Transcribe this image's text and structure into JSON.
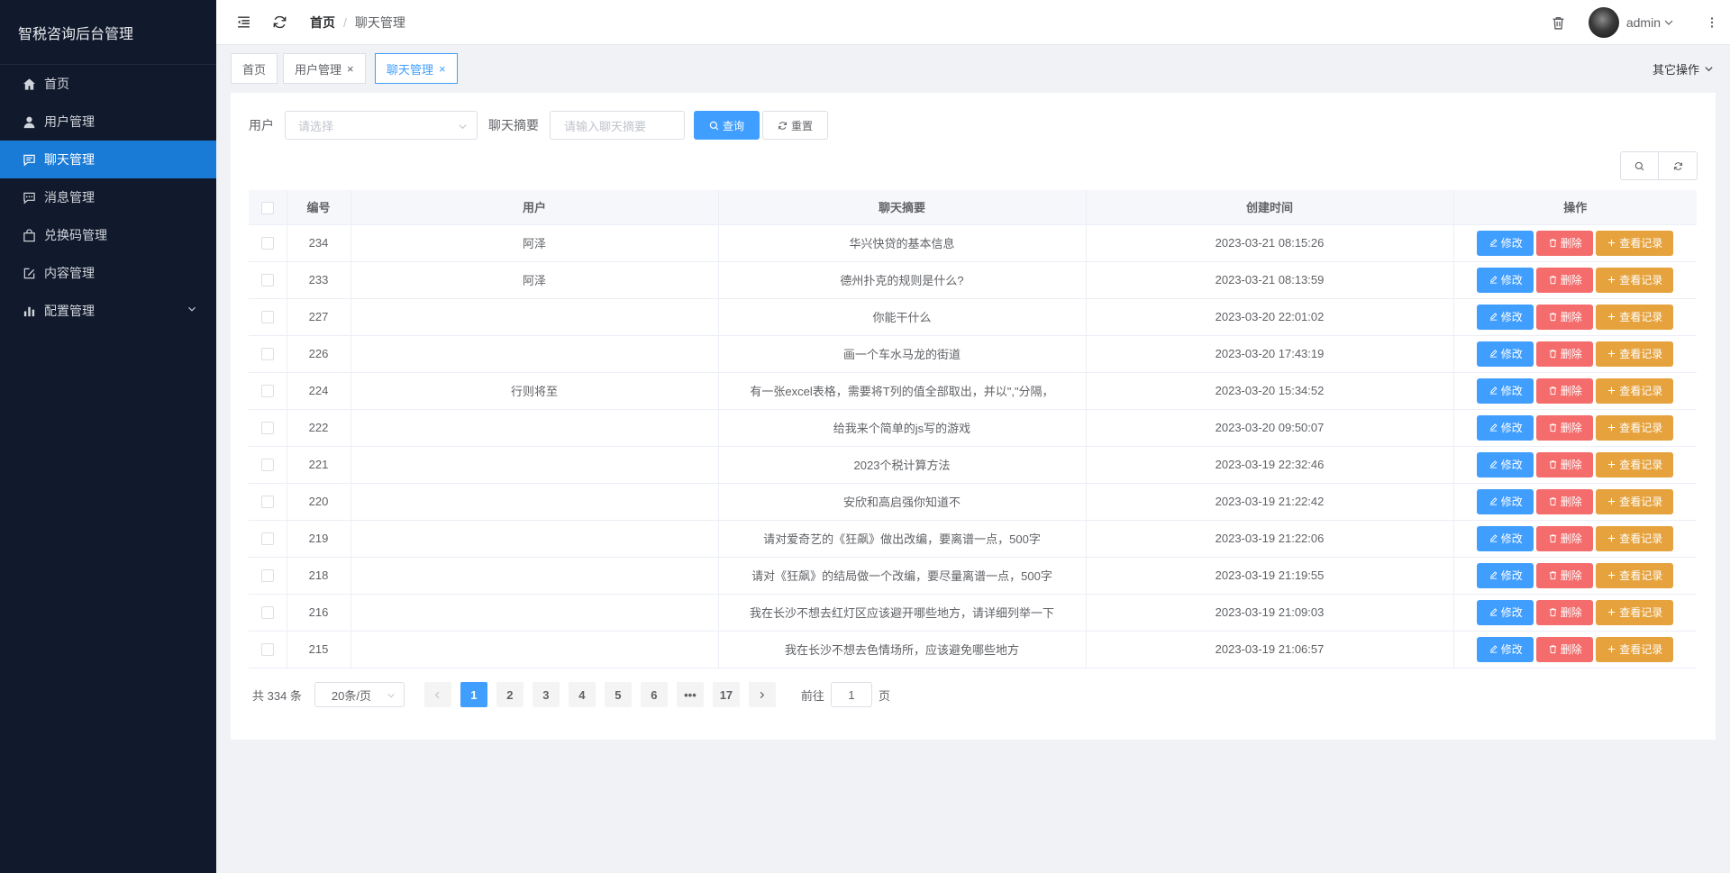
{
  "app": {
    "title": "智税咨询后台管理"
  },
  "sidebar": {
    "items": [
      {
        "label": "首页",
        "icon": "home-icon",
        "active": false
      },
      {
        "label": "用户管理",
        "icon": "user-icon",
        "active": false
      },
      {
        "label": "聊天管理",
        "icon": "chat-icon",
        "active": true
      },
      {
        "label": "消息管理",
        "icon": "message-icon",
        "active": false
      },
      {
        "label": "兑换码管理",
        "icon": "bag-icon",
        "active": false
      },
      {
        "label": "内容管理",
        "icon": "edit-icon",
        "active": false
      },
      {
        "label": "配置管理",
        "icon": "chart-icon",
        "active": false,
        "expandable": true
      }
    ]
  },
  "header": {
    "breadcrumb": [
      "首页",
      "聊天管理"
    ],
    "breadcrumb_sep": "/",
    "username": "admin"
  },
  "tabs": {
    "items": [
      {
        "label": "首页",
        "closable": false,
        "active": false
      },
      {
        "label": "用户管理",
        "closable": true,
        "active": false
      },
      {
        "label": "聊天管理",
        "closable": true,
        "active": true
      }
    ],
    "close_glyph": "×",
    "other_ops": "其它操作"
  },
  "filters": {
    "user_label": "用户",
    "user_placeholder": "请选择",
    "summary_label": "聊天摘要",
    "summary_placeholder": "请输入聊天摘要",
    "search_label": "查询",
    "reset_label": "重置"
  },
  "table": {
    "columns": [
      "编号",
      "用户",
      "聊天摘要",
      "创建时间",
      "操作"
    ],
    "rows": [
      {
        "id": "234",
        "user": "阿泽",
        "summary": "华兴快贷的基本信息",
        "created": "2023-03-21 08:15:26"
      },
      {
        "id": "233",
        "user": "阿泽",
        "summary": "德州扑克的规则是什么?",
        "created": "2023-03-21 08:13:59"
      },
      {
        "id": "227",
        "user": "",
        "summary": "你能干什么",
        "created": "2023-03-20 22:01:02"
      },
      {
        "id": "226",
        "user": "",
        "summary": "画一个车水马龙的街道",
        "created": "2023-03-20 17:43:19"
      },
      {
        "id": "224",
        "user": "行则将至",
        "summary": "有一张excel表格，需要将T列的值全部取出，并以\",\"分隔，",
        "created": "2023-03-20 15:34:52"
      },
      {
        "id": "222",
        "user": "",
        "summary": "给我来个简单的js写的游戏",
        "created": "2023-03-20 09:50:07"
      },
      {
        "id": "221",
        "user": "",
        "summary": "2023个税计算方法",
        "created": "2023-03-19 22:32:46"
      },
      {
        "id": "220",
        "user": "",
        "summary": "安欣和高启强你知道不",
        "created": "2023-03-19 21:22:42"
      },
      {
        "id": "219",
        "user": "",
        "summary": "请对爱奇艺的《狂飙》做出改编，要离谱一点，500字",
        "created": "2023-03-19 21:22:06"
      },
      {
        "id": "218",
        "user": "",
        "summary": "请对《狂飙》的结局做一个改编，要尽量离谱一点，500字",
        "created": "2023-03-19 21:19:55"
      },
      {
        "id": "216",
        "user": "",
        "summary": "我在长沙不想去红灯区应该避开哪些地方，请详细列举一下",
        "created": "2023-03-19 21:09:03"
      },
      {
        "id": "215",
        "user": "",
        "summary": "我在长沙不想去色情场所，应该避免哪些地方",
        "created": "2023-03-19 21:06:57"
      }
    ],
    "actions": {
      "edit": "修改",
      "delete": "删除",
      "records": "查看记录"
    }
  },
  "pagination": {
    "total_text": "共 334 条",
    "page_size": "20条/页",
    "pages": [
      "1",
      "2",
      "3",
      "4",
      "5",
      "6",
      "•••",
      "17"
    ],
    "current": "1",
    "goto_prefix": "前往",
    "goto_value": "1",
    "goto_suffix": "页"
  },
  "colors": {
    "sidebar_bg": "#111a2c",
    "sidebar_active": "#1a7bd6",
    "primary": "#409eff",
    "danger": "#f56c6c",
    "warning": "#e6a23c"
  }
}
